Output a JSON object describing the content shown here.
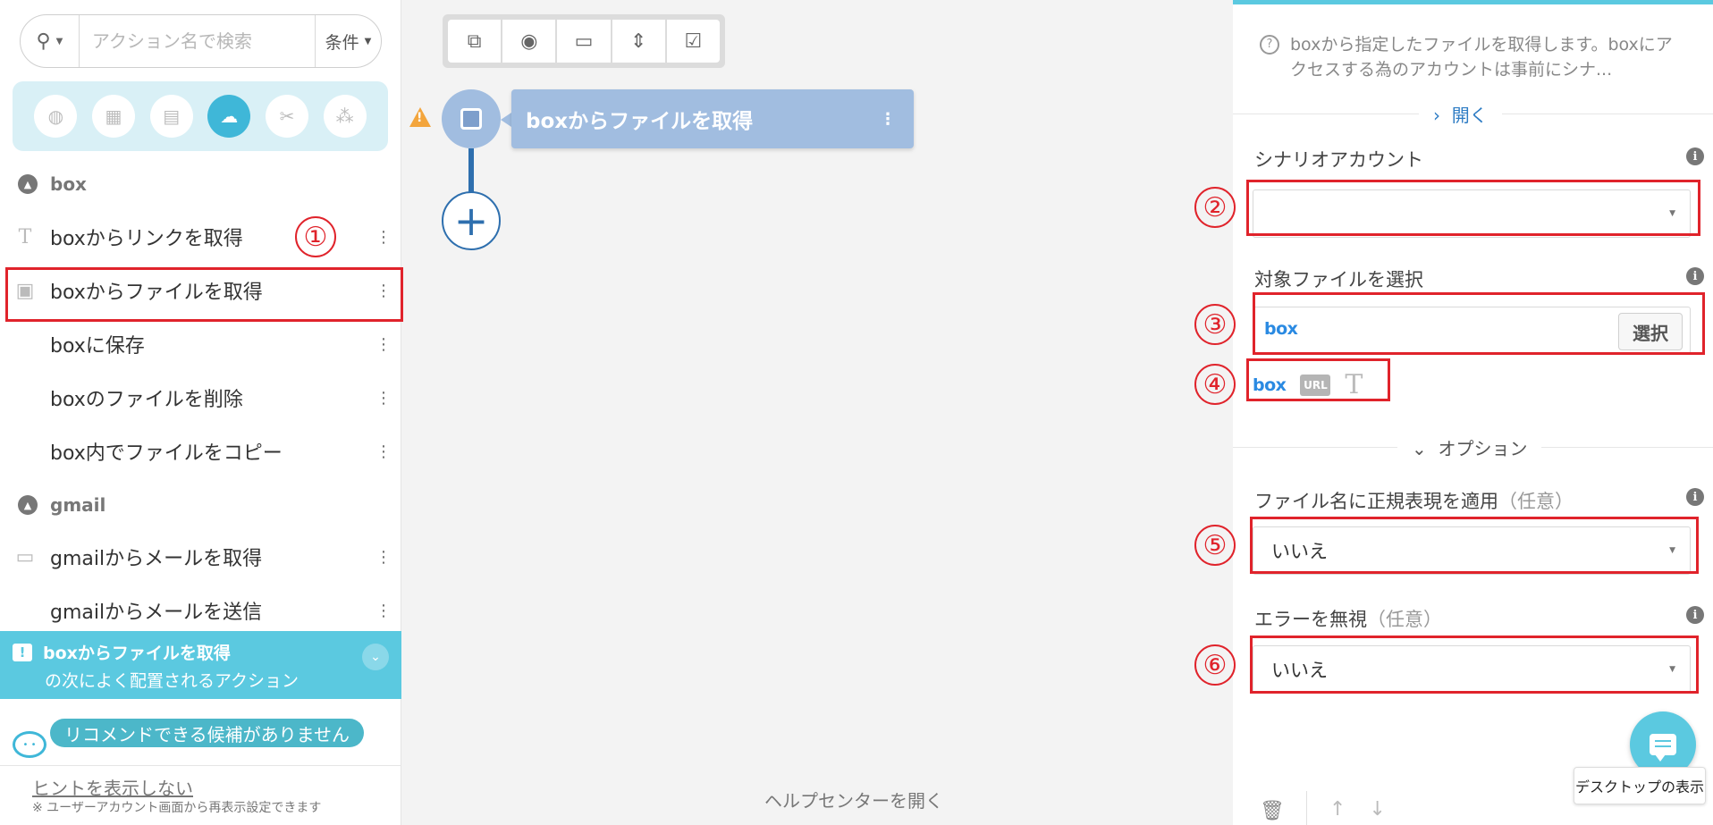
{
  "sidebar": {
    "search": {
      "placeholder": "アクション名で検索",
      "condition_label": "条件"
    },
    "categories": [
      {
        "icon": "globe-icon",
        "glyph": "◍"
      },
      {
        "icon": "excel-icon",
        "glyph": "▦"
      },
      {
        "icon": "document-icon",
        "glyph": "▤"
      },
      {
        "icon": "cloud-icon",
        "glyph": "☁",
        "active": true
      },
      {
        "icon": "tools-icon",
        "glyph": "✂"
      },
      {
        "icon": "blocks-icon",
        "glyph": "⁂"
      }
    ],
    "groups": [
      {
        "name": "box"
      },
      {
        "name": "gmail"
      }
    ],
    "items": [
      {
        "label": "boxからリンクを取得",
        "icon": "text-icon",
        "glyph": "T"
      },
      {
        "label": "boxからファイルを取得",
        "icon": "file-get-icon",
        "glyph": "▣"
      },
      {
        "label": "boxに保存",
        "icon": "",
        "glyph": ""
      },
      {
        "label": "boxのファイルを削除",
        "icon": "",
        "glyph": ""
      },
      {
        "label": "box内でファイルをコピー",
        "icon": "",
        "glyph": ""
      },
      {
        "label": "gmailからメールを取得",
        "icon": "mail-list-icon",
        "glyph": "▭"
      },
      {
        "label": "gmailからメールを送信",
        "icon": "",
        "glyph": ""
      }
    ],
    "recommend": {
      "title": "boxからファイルを取得",
      "subtitle": "の次によく配置されるアクション",
      "empty_message": "リコメンドできる候補がありません"
    },
    "hint": {
      "link": "ヒントを表示しない",
      "note": "※ ユーザーアカウント画面から再表示設定できます"
    }
  },
  "canvas": {
    "toolbar": [
      {
        "icon": "copy-icon",
        "glyph": "⧉"
      },
      {
        "icon": "eye-off-icon",
        "glyph": "◉"
      },
      {
        "icon": "comment-icon",
        "glyph": "▭"
      },
      {
        "icon": "collapse-icon",
        "glyph": "⇕"
      },
      {
        "icon": "delete-checked-icon",
        "glyph": "☑"
      }
    ],
    "node": {
      "label": "boxからファイルを取得"
    },
    "help_center": "ヘルプセンターを開く"
  },
  "panel": {
    "description": "boxから指定したファイルを取得します。boxにアクセスする為のアカウントは事前にシナ...",
    "open_label": "開く",
    "scenario_account": {
      "label": "シナリオアカウント",
      "value": ""
    },
    "target_file": {
      "label": "対象ファイルを選択",
      "logo": "box",
      "select_button": "選択"
    },
    "mode_icons": {
      "box": "box",
      "url": "URL",
      "text": "T"
    },
    "options_label": "オプション",
    "regex": {
      "label": "ファイル名に正規表現を適用",
      "optional": "（任意）",
      "value": "いいえ"
    },
    "ignore_error": {
      "label": "エラーを無視",
      "optional": "（任意）",
      "value": "いいえ"
    }
  },
  "annotations": [
    "①",
    "②",
    "③",
    "④",
    "⑤",
    "⑥"
  ],
  "tooltip": "デスクトップの表示",
  "colors": {
    "accent": "#5bc9e0",
    "node": "#a1bde0",
    "annotation_red": "#e0232b",
    "box_blue": "#2a8ae2",
    "link_blue": "#2e7cc4"
  }
}
